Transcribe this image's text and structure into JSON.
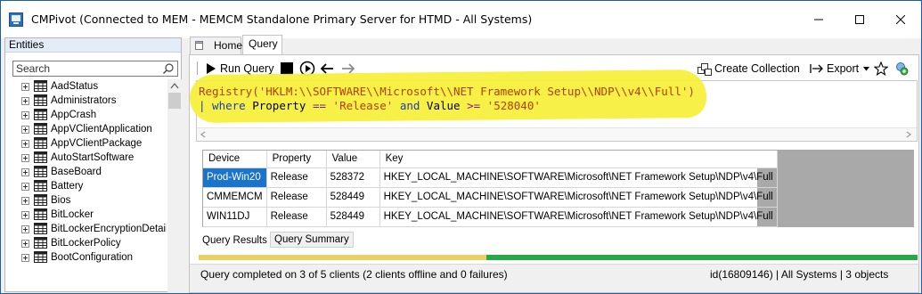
{
  "window": {
    "title": "CMPivot (Connected to MEM - MEMCM Standalone Primary Server for HTMD - All Systems)"
  },
  "entities": {
    "header": "Entities",
    "search_placeholder": "Search",
    "items": [
      {
        "label": "AadStatus"
      },
      {
        "label": "Administrators"
      },
      {
        "label": "AppCrash"
      },
      {
        "label": "AppVClientApplication"
      },
      {
        "label": "AppVClientPackage"
      },
      {
        "label": "AutoStartSoftware"
      },
      {
        "label": "BaseBoard"
      },
      {
        "label": "Battery"
      },
      {
        "label": "Bios"
      },
      {
        "label": "BitLocker"
      },
      {
        "label": "BitLockerEncryptionDetails"
      },
      {
        "label": "BitLockerPolicy"
      },
      {
        "label": "BootConfiguration"
      }
    ]
  },
  "tabs": {
    "home": "Home",
    "query": "Query"
  },
  "toolbar": {
    "run_query": "Run Query",
    "create_collection": "Create Collection",
    "export": "Export"
  },
  "editor": {
    "line1_prefix": "Registry(",
    "line1_string": "'HKLM:\\\\SOFTWARE\\\\Microsoft\\\\NET Framework Setup\\\\NDP\\\\v4\\\\Full'",
    "line1_suffix": ")",
    "line2_pipe": "| where",
    "line2_prop": " Property ",
    "line2_eq": "==",
    "line2_release": " 'Release' ",
    "line2_and": "and",
    "line2_value": " Value ",
    "line2_ge": ">=",
    "line2_num": " '528040'"
  },
  "results": {
    "columns": [
      "Device",
      "Property",
      "Value",
      "Key"
    ],
    "rows": [
      [
        "Prod-Win20",
        "Release",
        "528372",
        "HKEY_LOCAL_MACHINE\\SOFTWARE\\Microsoft\\NET Framework Setup\\NDP\\v4\\Full"
      ],
      [
        "CMMEMCM",
        "Release",
        "528449",
        "HKEY_LOCAL_MACHINE\\SOFTWARE\\Microsoft\\NET Framework Setup\\NDP\\v4\\Full"
      ],
      [
        "WIN11DJ",
        "Release",
        "528449",
        "HKEY_LOCAL_MACHINE\\SOFTWARE\\Microsoft\\NET Framework Setup\\NDP\\v4\\Full"
      ]
    ]
  },
  "bottom_tabs": {
    "results": "Query Results",
    "summary": "Query Summary"
  },
  "progress": {
    "offline_fraction": 0.4,
    "completed_fraction": 0.6,
    "offline_color": "#e9cf64",
    "completed_color": "#27a84a"
  },
  "status": {
    "message": "Query completed on 3 of 5 clients (2 clients offline and 0 failures)",
    "right": "id(16809146)  |  All Systems  |  3 objects"
  },
  "colors": {
    "highlight": "#f7ef3c",
    "selection": "#1a74c9",
    "desktop": "#1b7fd1"
  }
}
